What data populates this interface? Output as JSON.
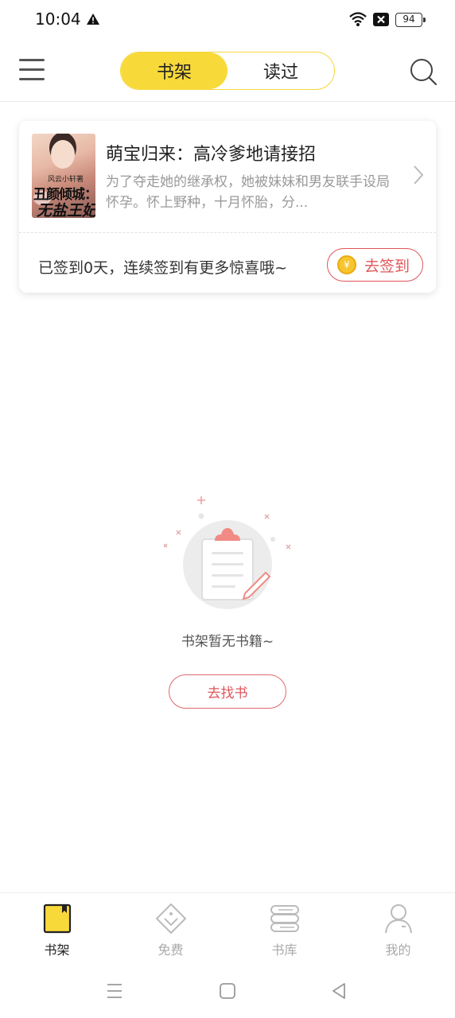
{
  "status_bar": {
    "time": "10:04",
    "battery": "94"
  },
  "header": {
    "tabs": [
      {
        "label": "书架",
        "active": true
      },
      {
        "label": "读过",
        "active": false
      }
    ]
  },
  "book_card": {
    "title": "萌宝归来：高冷爹地请接招",
    "description": "为了夺走她的继承权，她被妹妹和男友联手设局怀孕。怀上野种，十月怀胎，分...",
    "cover": {
      "top_text": "风云小轩著",
      "title_text": "丑颜倾城：",
      "subtitle_text": "无盐王妃"
    },
    "signin_text": "已签到0天，连续签到有更多惊喜哦~",
    "signin_button": "去签到",
    "coin_symbol": "¥"
  },
  "empty_state": {
    "message": "书架暂无书籍~",
    "button": "去找书"
  },
  "bottom_nav": [
    {
      "label": "书架",
      "icon": "bookshelf-icon",
      "active": true
    },
    {
      "label": "免费",
      "icon": "tag-icon",
      "active": false
    },
    {
      "label": "书库",
      "icon": "library-icon",
      "active": false
    },
    {
      "label": "我的",
      "icon": "profile-icon",
      "active": false
    }
  ],
  "colors": {
    "accent_yellow": "#f8d93a",
    "accent_red": "#e0565a"
  }
}
